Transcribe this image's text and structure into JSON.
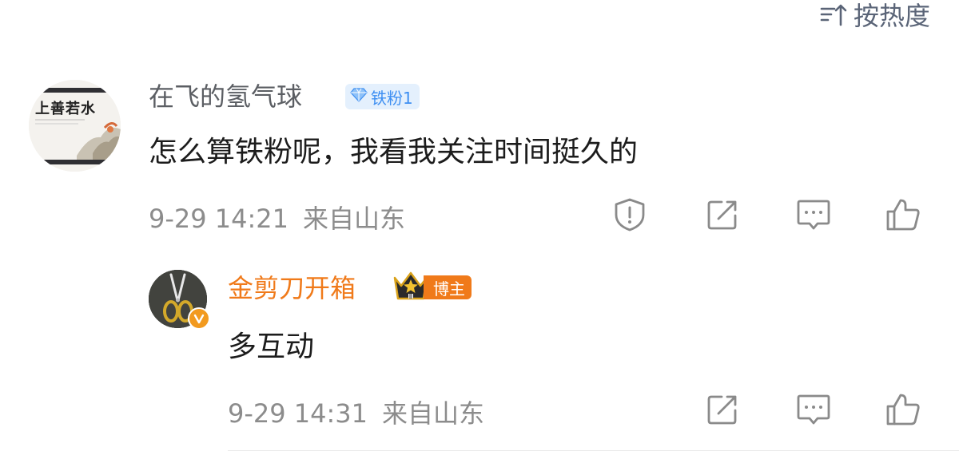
{
  "sort": {
    "label": "按热度",
    "icon": "sort-icon"
  },
  "comment": {
    "username": "在飞的氢气球",
    "badge": "铁粉1",
    "badge_color": "#3e8ff2",
    "text": "怎么算铁粉呢，我看我关注时间挺久的",
    "time": "9-29 14:21",
    "location": "来自山东",
    "avatar_text": "上善若水",
    "actions": [
      "report-icon",
      "share-icon",
      "reply-icon",
      "like-icon"
    ]
  },
  "reply": {
    "username": "金剪刀开箱",
    "username_color": "#f07a1a",
    "badge": "博主",
    "text": "多互动",
    "time": "9-29 14:31",
    "location": "来自山东",
    "actions": [
      "share-icon",
      "reply-icon",
      "like-icon"
    ]
  }
}
